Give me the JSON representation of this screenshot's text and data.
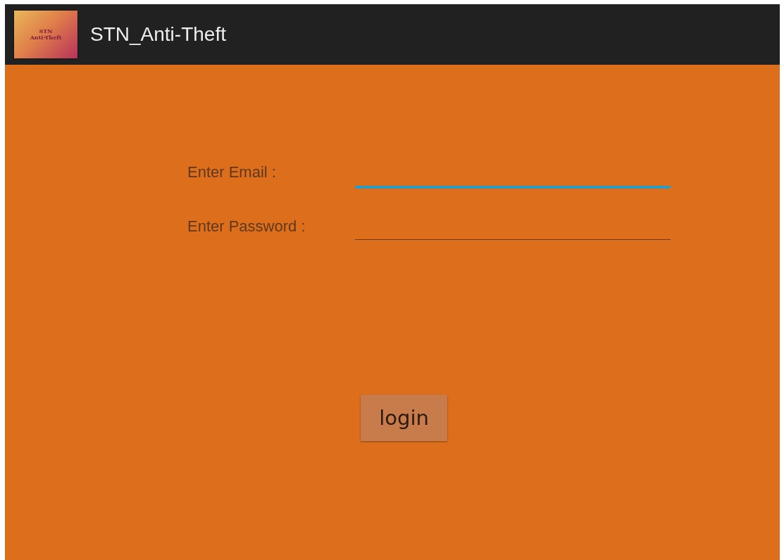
{
  "app_bar": {
    "logo_lines": [
      "STN",
      "Anti-Theft"
    ],
    "title": "STN_Anti-Theft"
  },
  "form": {
    "fields": [
      {
        "label": "Enter Email :",
        "focused": true
      },
      {
        "label": "Enter Password :",
        "focused": false
      }
    ],
    "button": "login"
  }
}
